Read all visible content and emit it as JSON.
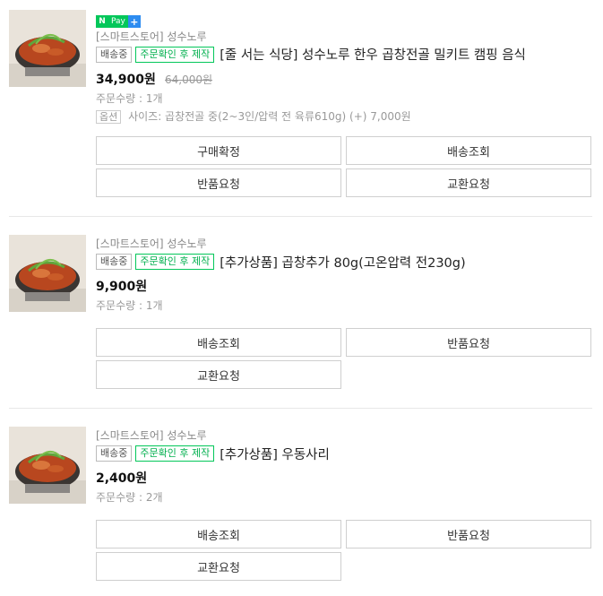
{
  "orders": [
    {
      "pay_badge": {
        "n": "N",
        "text": "Pay",
        "plus": "+"
      },
      "store": "[스마트스토어] 성수노루",
      "tags": [
        "배송중",
        "주문확인 후 제작"
      ],
      "title": "[줄 서는 식당] 성수노루 한우 곱창전골 밀키트 캠핑 음식",
      "price": "34,900원",
      "original_price": "64,000원",
      "quantity": "주문수량 : 1개",
      "option_label": "옵션",
      "option_text": "사이즈: 곱창전골 중(2~3인/압력 전 육류610g) (+) 7,000원",
      "buttons": [
        "구매확정",
        "배송조회",
        "반품요청",
        "교환요청"
      ]
    },
    {
      "store": "[스마트스토어] 성수노루",
      "tags": [
        "배송중",
        "주문확인 후 제작"
      ],
      "title": "[추가상품] 곱창추가 80g(고온압력 전230g)",
      "price": "9,900원",
      "quantity": "주문수량 : 1개",
      "buttons": [
        "배송조회",
        "반품요청",
        "교환요청"
      ]
    },
    {
      "store": "[스마트스토어] 성수노루",
      "tags": [
        "배송중",
        "주문확인 후 제작"
      ],
      "title": "[추가상품] 우동사리",
      "price": "2,400원",
      "quantity": "주문수량 : 2개",
      "buttons": [
        "배송조회",
        "반품요청",
        "교환요청"
      ]
    }
  ],
  "colors": {
    "naver_green": "#03c75a",
    "tag_green": "#03b04f",
    "plus_blue": "#2d8cf0",
    "divider": "#e8e8e8"
  }
}
